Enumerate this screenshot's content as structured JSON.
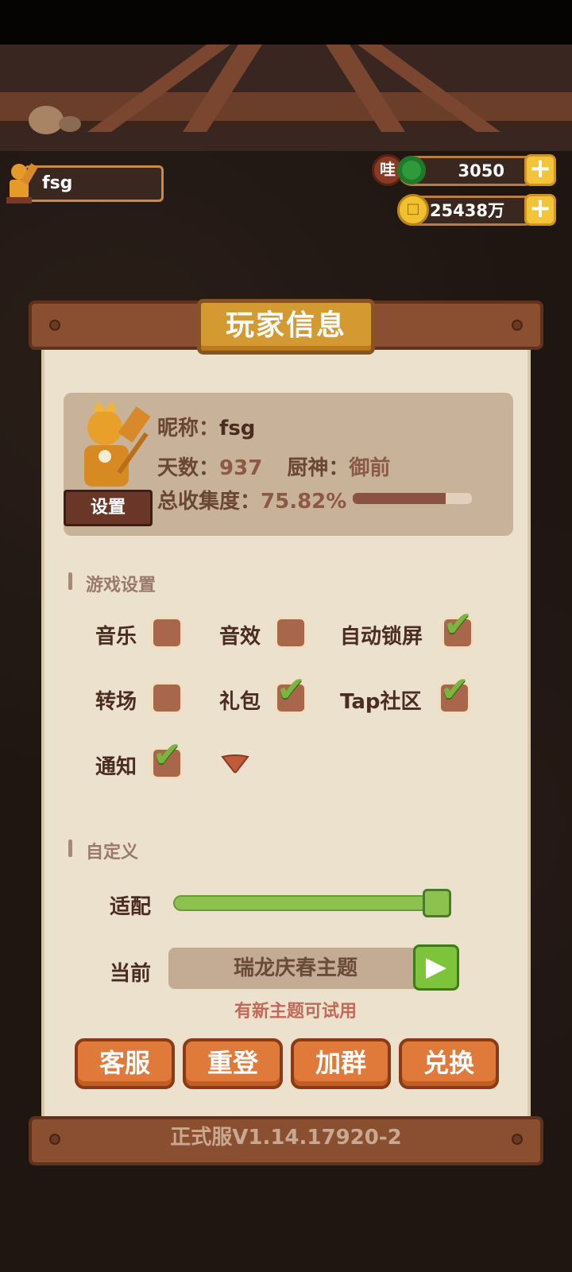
{
  "header": {
    "player_name": "fsg",
    "jade_prefix": "哇",
    "jade_amount": "3050",
    "coin_amount": "25438万",
    "plus": "+"
  },
  "panel": {
    "title": "玩家信息",
    "nickname_label": "昵称：",
    "nickname_value": "fsg",
    "days_label": "天数：",
    "days_value": "937",
    "chef_label": "厨神：",
    "chef_value": "御前",
    "collection_label": "总收集度：",
    "collection_value": "75.82%",
    "collection_progress": 0.78,
    "settings_label": "设置"
  },
  "game_settings": {
    "title": "游戏设置",
    "options": [
      {
        "label": "音乐",
        "checked": false
      },
      {
        "label": "音效",
        "checked": false
      },
      {
        "label": "自动锁屏",
        "checked": true
      },
      {
        "label": "转场",
        "checked": false
      },
      {
        "label": "礼包",
        "checked": true
      },
      {
        "label": "Tap社区",
        "checked": true
      },
      {
        "label": "通知",
        "checked": true
      }
    ],
    "tick": "✔"
  },
  "custom": {
    "title": "自定义",
    "fit_label": "适配",
    "fit_level": 0.95,
    "current_label": "当前",
    "theme_name": "瑞龙庆春主题",
    "play_icon": "▶",
    "hint": "有新主题可试用"
  },
  "buttons": {
    "service": "客服",
    "relogin": "重登",
    "join_group": "加群",
    "redeem": "兑换"
  },
  "version": "正式服V1.14.17920-2",
  "colors": {
    "accent_green": "#8dc24e",
    "button_orange": "#e07a3a",
    "panel_cream": "#ece1cc"
  }
}
